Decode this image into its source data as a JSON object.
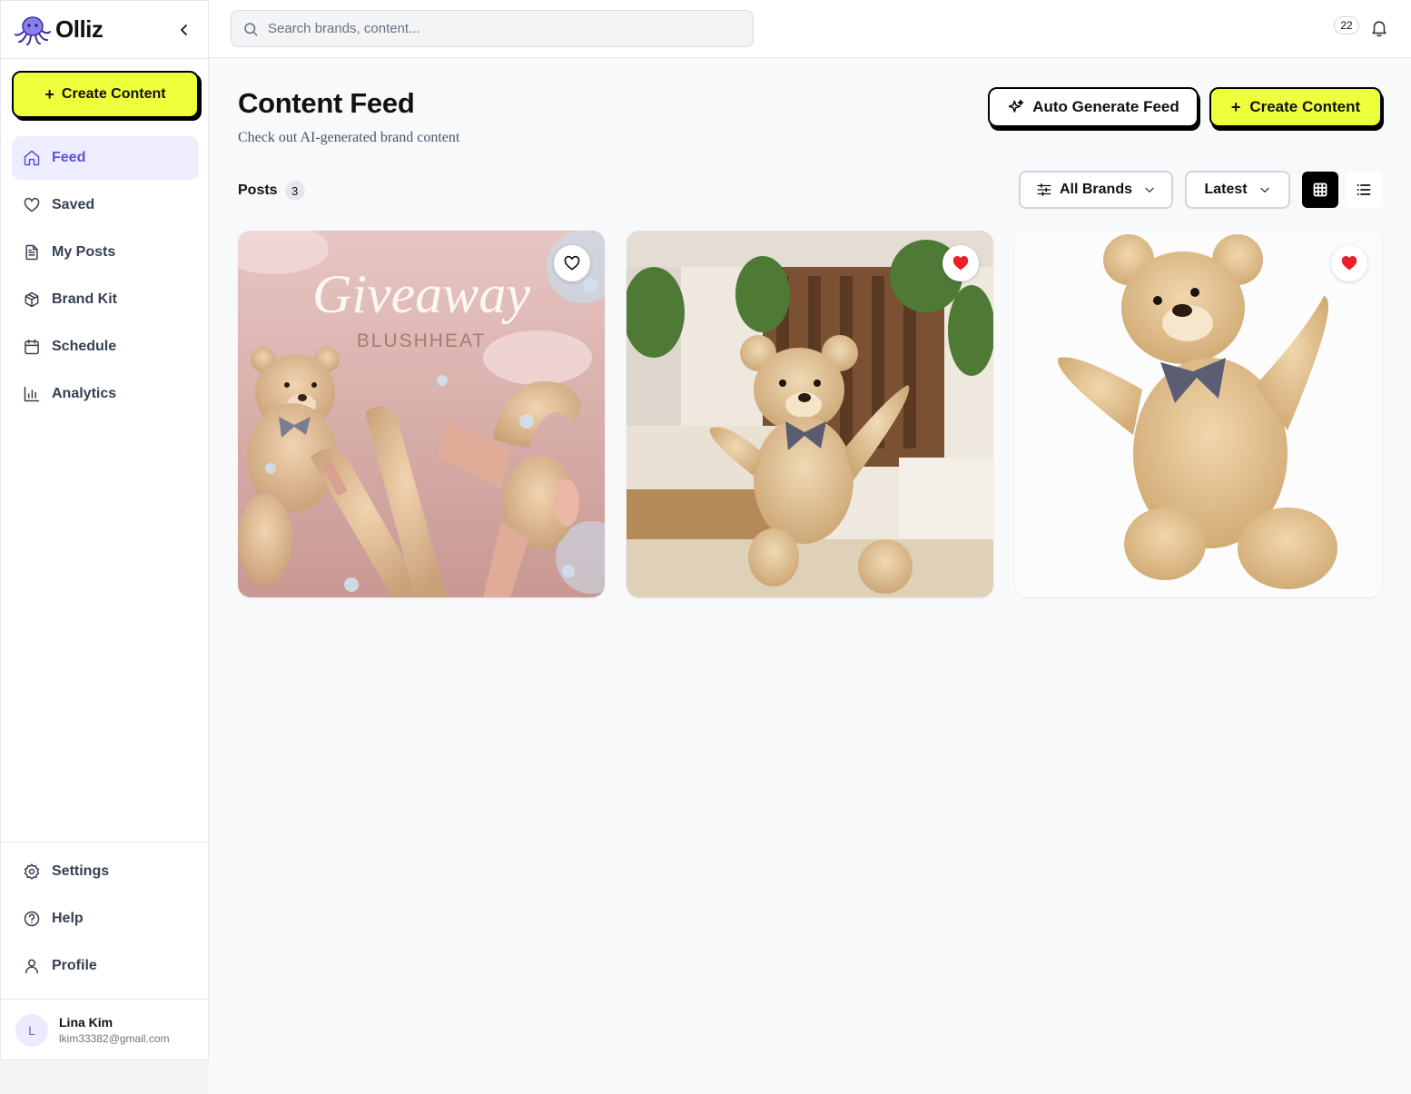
{
  "app": {
    "name": "Olliz"
  },
  "sidebar": {
    "create_label": "Create Content",
    "items": [
      {
        "label": "Feed",
        "icon": "home-icon",
        "active": true
      },
      {
        "label": "Saved",
        "icon": "heart-icon",
        "active": false
      },
      {
        "label": "My Posts",
        "icon": "document-icon",
        "active": false
      },
      {
        "label": "Brand Kit",
        "icon": "package-icon",
        "active": false
      },
      {
        "label": "Schedule",
        "icon": "calendar-icon",
        "active": false
      },
      {
        "label": "Analytics",
        "icon": "bar-chart-icon",
        "active": false
      }
    ],
    "bottom_items": [
      {
        "label": "Settings",
        "icon": "gear-icon"
      },
      {
        "label": "Help",
        "icon": "help-circle-icon"
      },
      {
        "label": "Profile",
        "icon": "user-icon"
      }
    ],
    "user": {
      "initial": "L",
      "name": "Lina Kim",
      "email": "lkim33382@gmail.com"
    }
  },
  "topbar": {
    "search_placeholder": "Search brands, content...",
    "notification_count": "22"
  },
  "main": {
    "title": "Content Feed",
    "subtitle": "Check out AI-generated brand content",
    "auto_generate_label": "Auto Generate Feed",
    "create_label": "Create Content",
    "posts_label": "Posts",
    "posts_count": "3",
    "brand_filter": "All Brands",
    "sort": "Latest",
    "view_mode": "grid"
  },
  "posts": [
    {
      "title_script": "Giveaway",
      "brand_text": "BLUSHHEAT",
      "liked": false
    },
    {
      "liked": true
    },
    {
      "liked": true
    }
  ],
  "colors": {
    "accent_yellow": "#eeff3b",
    "active_purple": "#5b50e6",
    "heart_red": "#ef1c2a"
  }
}
